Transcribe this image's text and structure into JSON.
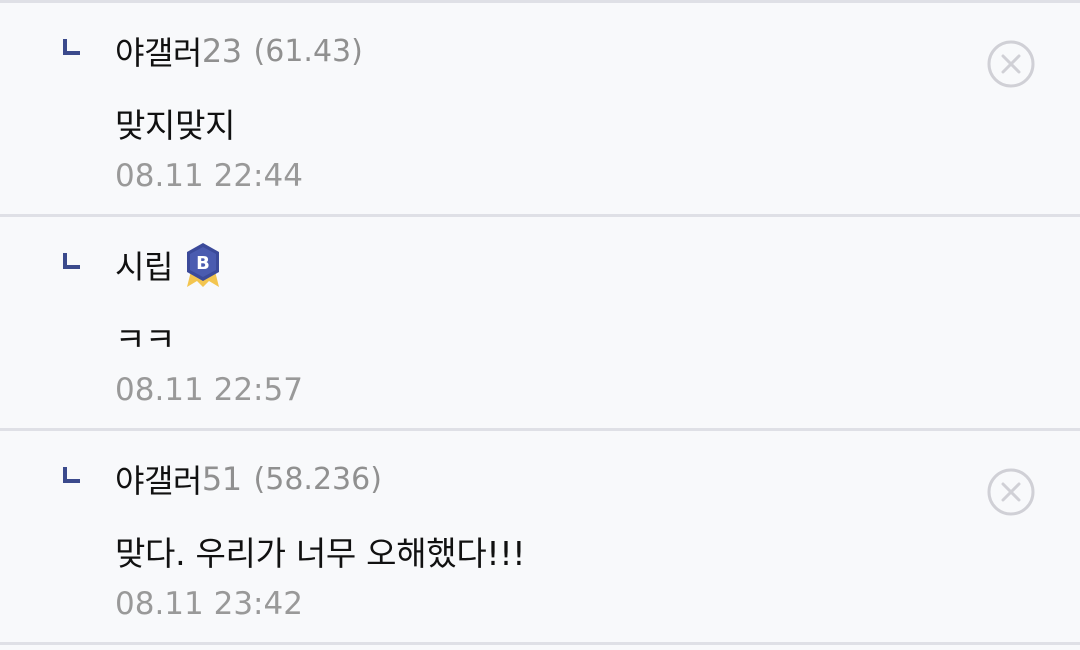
{
  "comments": [
    {
      "nick_name": "야갤러",
      "nick_num": "23",
      "ip": "(61.43)",
      "text": "맞지맞지",
      "date": "08.11 22:44",
      "deletable": true
    },
    {
      "nick_name": "시립",
      "nick_num": "",
      "ip": "",
      "badge": "B",
      "text": "ㅋㅋ",
      "date": "08.11 22:57",
      "deletable": false
    },
    {
      "nick_name": "야갤러",
      "nick_num": "51",
      "ip": "(58.236)",
      "text": "맞다. 우리가 너무 오해했다!!!",
      "date": "08.11 23:42",
      "deletable": true
    }
  ],
  "colors": {
    "reply_icon": "#3b4a8c",
    "badge_fill": "#3b4a9a",
    "badge_ribbon": "#f3c54f",
    "delete_icon": "#d0d0d6",
    "divider": "#dfe0e6",
    "background": "#f8f9fb"
  },
  "icons": {
    "reply": "reply-arrow-icon",
    "delete": "close-circle-icon",
    "badge": "member-badge-icon"
  }
}
